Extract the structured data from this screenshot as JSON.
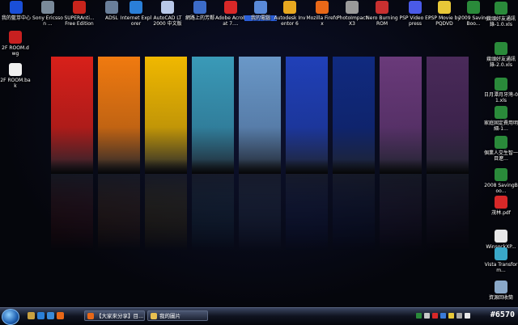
{
  "desktop": {
    "top_icons": [
      {
        "label": "我的藍芽中心",
        "icon": "bluetooth-icon",
        "color": "#1a4fd8"
      },
      {
        "label": "Sony Ericsson ...",
        "icon": "phone-icon",
        "color": "#7a8a9a"
      },
      {
        "label": "SUPERAnti... Free Edition",
        "icon": "shield-icon",
        "color": "#c8241c"
      },
      {
        "label": "ADSL",
        "icon": "network-icon",
        "color": "#6a7f9a"
      },
      {
        "label": "Internet Explorer",
        "icon": "ie-icon",
        "color": "#2a7fd8"
      },
      {
        "label": "AutoCAD LT 2000 中文版",
        "icon": "autocad-icon",
        "color": "#b8c8e8"
      },
      {
        "label": "網路上的芳鄰",
        "icon": "network-places-icon",
        "color": "#3c6cc8"
      },
      {
        "label": "Adobe Acrobat 7....",
        "icon": "acrobat-icon",
        "color": "#d82828"
      },
      {
        "label": "我的電腦",
        "icon": "computer-icon",
        "color": "#5a8ad8"
      },
      {
        "label": "Autodesk Inventor 6",
        "icon": "inventor-icon",
        "color": "#e8a820"
      },
      {
        "label": "Mozilla Firefox",
        "icon": "firefox-icon",
        "color": "#e86818"
      },
      {
        "label": "PhotoImpact X3",
        "icon": "photoimpact-icon",
        "color": "#9a9a9a"
      },
      {
        "label": "Nero Burning ROM",
        "icon": "nero-icon",
        "color": "#c83030"
      },
      {
        "label": "PSP Video Express",
        "icon": "psp-video-icon",
        "color": "#4a5ae8"
      },
      {
        "label": "PSP Movie by PQDVD",
        "icon": "psp-movie-icon",
        "color": "#e8c838"
      },
      {
        "label": "2009 SavingBoo...",
        "icon": "excel-file-icon",
        "color": "#2a8a3a"
      }
    ],
    "left_icons": [
      {
        "label": "2F ROOM.dwg",
        "icon": "dwg-file-icon",
        "color": "#c82020"
      },
      {
        "label": "2F ROOM.bak",
        "icon": "bak-file-icon",
        "color": "#f0f0f0"
      }
    ],
    "right_icons": [
      {
        "label": "幾頭好友通訊錄-1.0.xls",
        "icon": "excel-file-icon",
        "color": "#2a8a3a"
      },
      {
        "label": "幾頭好友通訊錄-2.0.xls",
        "icon": "excel-file-icon",
        "color": "#2a8a3a"
      },
      {
        "label": "日月潭月牙灣-01.xls",
        "icon": "excel-file-icon",
        "color": "#2a8a3a"
      },
      {
        "label": "家庭固定費用明細-1...",
        "icon": "excel-file-icon",
        "color": "#2a8a3a"
      },
      {
        "label": "個業人交生智一目遼...",
        "icon": "excel-file-icon",
        "color": "#2a8a3a"
      },
      {
        "label": "2008 SavingBoo...",
        "icon": "excel-file-icon",
        "color": "#2a8a3a"
      },
      {
        "label": "茂林.pdf",
        "icon": "pdf-file-icon",
        "color": "#d82828"
      },
      {
        "label": "WinsockXP...",
        "icon": "winsock-file-icon",
        "color": "#e8e8e8"
      },
      {
        "label": "Vista Transform...",
        "icon": "vista-transform-icon",
        "color": "#3aa8c8"
      },
      {
        "label": "資源回收筒",
        "icon": "recycle-bin-icon",
        "color": "#8aa8c8"
      }
    ],
    "wallpaper_colors": [
      "#d8201a",
      "#f07a10",
      "#f0b800",
      "#3a9ab8",
      "#6a98c8",
      "#2040b8",
      "#102a80",
      "#6a3a7a",
      "#4a2a5a"
    ]
  },
  "taskbar": {
    "start_icon": "windows-start-icon",
    "quick_launch": [
      {
        "icon": "show-desktop-icon",
        "color": "#c8a040"
      },
      {
        "icon": "ie-icon",
        "color": "#2a7fd8"
      },
      {
        "icon": "media-player-icon",
        "color": "#3a8ad8"
      },
      {
        "icon": "firefox-icon",
        "color": "#e86818"
      }
    ],
    "tasks": [
      {
        "label": "【大家來分享】目...",
        "icon": "firefox-icon",
        "color": "#e86818"
      },
      {
        "label": "我的圖片",
        "icon": "folder-icon",
        "color": "#e8c050"
      }
    ],
    "tray_icons": [
      {
        "icon": "tray-icon-1",
        "color": "#2a8a3a"
      },
      {
        "icon": "tray-icon-2",
        "color": "#c8c8c8"
      },
      {
        "icon": "tray-icon-3",
        "color": "#d82828"
      },
      {
        "icon": "tray-icon-4",
        "color": "#3a7ad8"
      },
      {
        "icon": "tray-icon-5",
        "color": "#e8c838"
      },
      {
        "icon": "tray-icon-6",
        "color": "#a8a8a8"
      },
      {
        "icon": "volume-icon",
        "color": "#e8e8e8"
      }
    ],
    "clock": "#6570"
  }
}
